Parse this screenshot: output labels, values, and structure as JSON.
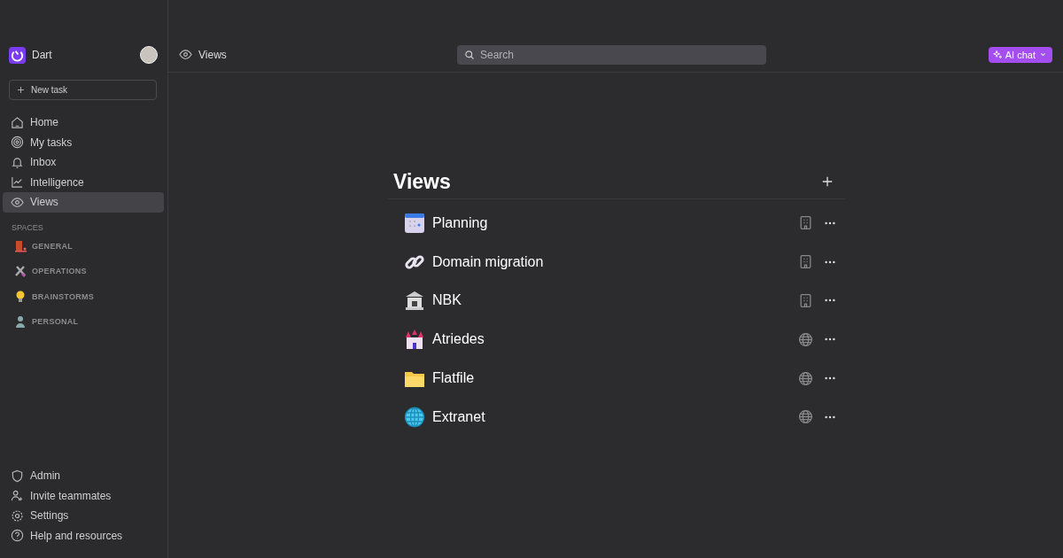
{
  "workspace": {
    "name": "Dart"
  },
  "new_task": {
    "label": "New task"
  },
  "nav": [
    {
      "label": "Home",
      "selected": false
    },
    {
      "label": "My tasks",
      "selected": false
    },
    {
      "label": "Inbox",
      "selected": false
    },
    {
      "label": "Intelligence",
      "selected": false
    },
    {
      "label": "Views",
      "selected": true
    }
  ],
  "spaces": {
    "heading": "SPACES",
    "items": [
      {
        "label": "GENERAL"
      },
      {
        "label": "OPERATIONS"
      },
      {
        "label": "BRAINSTORMS"
      },
      {
        "label": "PERSONAL"
      }
    ]
  },
  "footer_nav": [
    {
      "label": "Admin"
    },
    {
      "label": "Invite teammates"
    },
    {
      "label": "Settings"
    },
    {
      "label": "Help and resources"
    }
  ],
  "header": {
    "breadcrumb": "Views",
    "search": {
      "placeholder": "Search"
    },
    "ai_button": "AI chat"
  },
  "views": {
    "title": "Views",
    "items": [
      {
        "name": "Planning",
        "public": false
      },
      {
        "name": "Domain migration",
        "public": false
      },
      {
        "name": "NBK",
        "public": false
      },
      {
        "name": "Atriedes",
        "public": true
      },
      {
        "name": "Flatfile",
        "public": true
      },
      {
        "name": "Extranet",
        "public": true
      }
    ]
  }
}
